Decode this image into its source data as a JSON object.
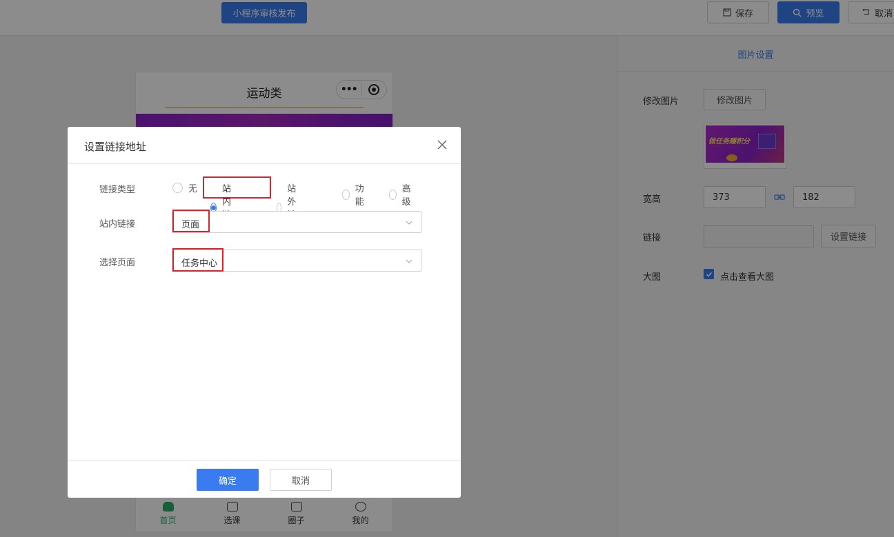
{
  "topbar": {
    "publish_label": "小程序审核发布",
    "save_label": "保存",
    "preview_label": "预览",
    "cancel_label": "取消"
  },
  "phone": {
    "title": "运动类",
    "tabs": [
      {
        "label": "首页",
        "icon": "home-icon",
        "active": true
      },
      {
        "label": "选课",
        "icon": "book-icon",
        "active": false
      },
      {
        "label": "圈子",
        "icon": "chat-icon",
        "active": false
      },
      {
        "label": "我的",
        "icon": "face-icon",
        "active": false
      }
    ]
  },
  "right_panel": {
    "tab_label": "图片设置",
    "modify_image_label": "修改图片",
    "modify_image_button": "修改图片",
    "thumbnail_text": "做任务赚积分",
    "size_label": "宽高",
    "width_value": "373",
    "height_value": "182",
    "link_label": "链接",
    "link_value": "",
    "set_link_button": "设置链接",
    "big_image_label": "大图",
    "big_image_checkbox_label": "点击查看大图",
    "big_image_checked": true
  },
  "dialog": {
    "title": "设置链接地址",
    "link_type_label": "链接类型",
    "link_type_options": [
      "无",
      "站内链接",
      "站外链接",
      "功能",
      "高级"
    ],
    "link_type_selected": "站内链接",
    "internal_link_label": "站内链接",
    "internal_link_value": "页面",
    "select_page_label": "选择页面",
    "select_page_value": "任务中心",
    "ok_label": "确定",
    "cancel_label": "取消"
  },
  "colors": {
    "primary": "#3a7cf0",
    "highlight": "#d9232d",
    "tab_active": "#2bae66"
  }
}
